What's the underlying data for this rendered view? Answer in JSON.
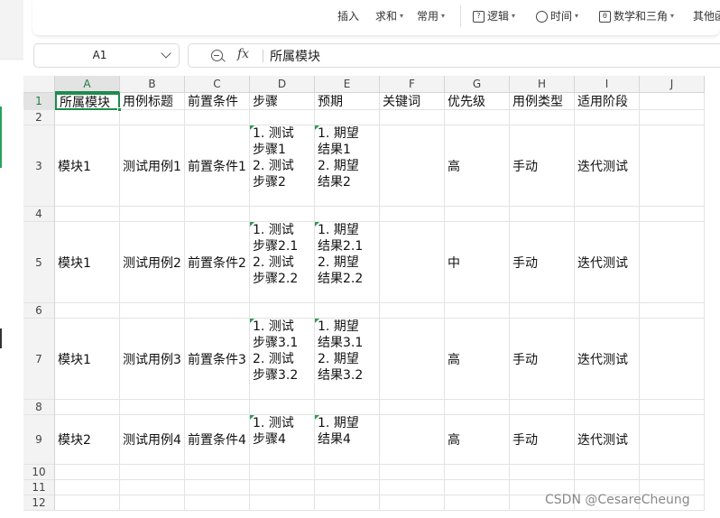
{
  "toolbar": {
    "insert_label": "插入",
    "sum_label": "求和",
    "common_label": "常用",
    "logic_label": "逻辑",
    "time_label": "时间",
    "math_label": "数学和三角",
    "other_label": "其他函"
  },
  "name_box": {
    "value": "A1"
  },
  "formula_bar": {
    "fx_label": "fx",
    "value": "所属模块"
  },
  "columns": [
    "A",
    "B",
    "C",
    "D",
    "E",
    "F",
    "G",
    "H",
    "I",
    "J"
  ],
  "rows": [
    "1",
    "2",
    "3",
    "4",
    "5",
    "6",
    "7",
    "8",
    "9",
    "10",
    "11",
    "12"
  ],
  "selected_cell": "A1",
  "header_row": [
    "所属模块",
    "用例标题",
    "前置条件",
    "步骤",
    "预期",
    "关键词",
    "优先级",
    "用例类型",
    "适用阶段"
  ],
  "test_cases": [
    {
      "module": "模块1",
      "title": "测试用例1",
      "precondition": "前置条件1",
      "steps": [
        "1. 测试",
        "步骤1",
        "2. 测试",
        "步骤2"
      ],
      "expected": [
        "1. 期望",
        "结果1",
        "2. 期望",
        "结果2"
      ],
      "keyword": "",
      "priority": "高",
      "type": "手动",
      "stage": "迭代测试"
    },
    {
      "module": "模块1",
      "title": "测试用例2",
      "precondition": "前置条件2",
      "steps": [
        "1. 测试",
        "步骤2.1",
        "2. 测试",
        "步骤2.2"
      ],
      "expected": [
        "1. 期望",
        "结果2.1",
        "2. 期望",
        "结果2.2"
      ],
      "keyword": "",
      "priority": "中",
      "type": "手动",
      "stage": "迭代测试"
    },
    {
      "module": "模块1",
      "title": "测试用例3",
      "precondition": "前置条件3",
      "steps": [
        "1. 测试",
        "步骤3.1",
        "2. 测试",
        "步骤3.2"
      ],
      "expected": [
        "1. 期望",
        "结果3.1",
        "2. 期望",
        "结果3.2"
      ],
      "keyword": "",
      "priority": "高",
      "type": "手动",
      "stage": "迭代测试"
    },
    {
      "module": "模块2",
      "title": "测试用例4",
      "precondition": "前置条件4",
      "steps": [
        "1. 测试",
        "步骤4"
      ],
      "expected": [
        "1. 期望",
        "结果4"
      ],
      "keyword": "",
      "priority": "高",
      "type": "手动",
      "stage": "迭代测试"
    }
  ],
  "watermark": "CSDN @CesareCheung",
  "colors": {
    "accent": "#1f8a4c",
    "header_bg": "#f3f3f3",
    "gridline": "#e3e3e3"
  }
}
